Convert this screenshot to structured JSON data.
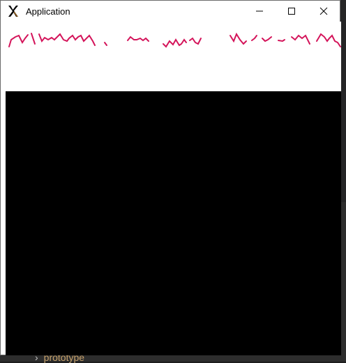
{
  "window": {
    "title": "Application",
    "controls": {
      "minimize": "minimize-icon",
      "maximize": "maximize-icon",
      "close": "close-icon"
    }
  },
  "background": {
    "partial_text": "prototype"
  },
  "colors": {
    "stroke": "#d4145a",
    "canvas_top": "#ffffff",
    "canvas_bottom": "#000000"
  }
}
